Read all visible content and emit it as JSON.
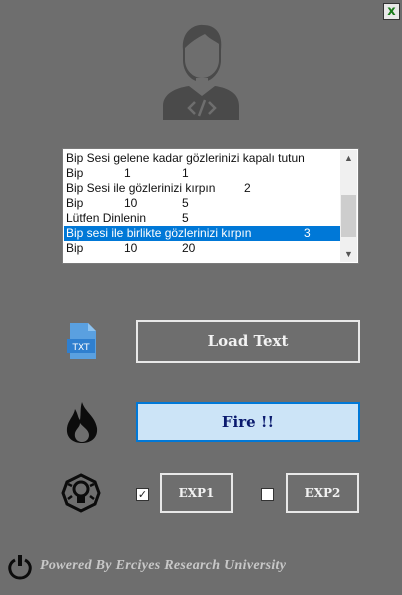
{
  "window": {
    "close_glyph": "x"
  },
  "list": {
    "items": [
      {
        "a": "Bip Sesi gelene kadar gözlerinizi kapalı tutun",
        "b": "",
        "c": ""
      },
      {
        "a": "Bip",
        "b": "1",
        "c": "1"
      },
      {
        "a": "Bip Sesi ile gözlerinizi kırpın",
        "b": "2",
        "c": ""
      },
      {
        "a": "Bip",
        "b": "10",
        "c": "5"
      },
      {
        "a": "Lütfen Dinlenin",
        "b": "5",
        "c": ""
      },
      {
        "a": "Bip sesi ile birlikte gözlerinizi kırpın",
        "b": "3",
        "c": "",
        "selected": true
      },
      {
        "a": "Bip",
        "b": "10",
        "c": "20"
      }
    ],
    "scroll_up": "▲",
    "scroll_down": "▼"
  },
  "buttons": {
    "load_text": "Load Text",
    "fire": "Fire !!",
    "exp1": "EXP1",
    "exp2": "EXP2"
  },
  "checkboxes": {
    "exp1_checked": true,
    "exp2_checked": false
  },
  "icons": {
    "avatar": "developer-avatar-icon",
    "file": "text-file-icon",
    "fire": "fire-icon",
    "brain": "brain-icon",
    "power": "power-icon"
  },
  "footer": {
    "text": "Powered By Erciyes Research University"
  },
  "colors": {
    "background": "#6e6e6e",
    "selection": "#0078d7",
    "fire_button": "#cce4f7"
  }
}
